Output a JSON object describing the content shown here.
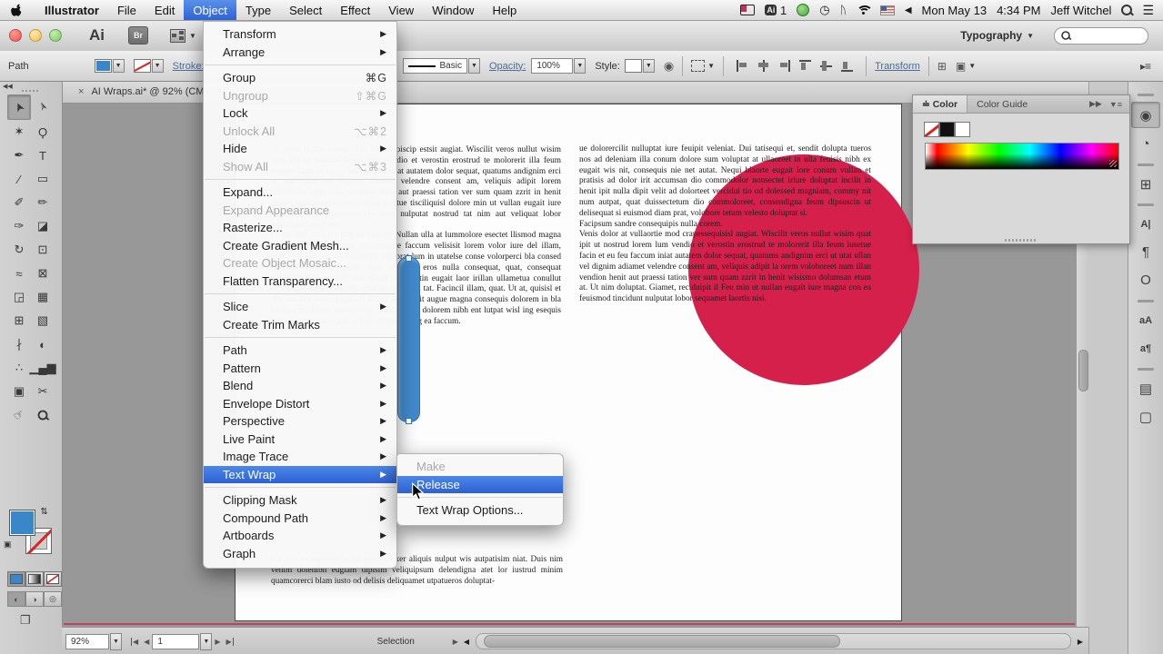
{
  "menubar": {
    "items": [
      "Illustrator",
      "File",
      "Edit",
      "Object",
      "Type",
      "Select",
      "Effect",
      "View",
      "Window",
      "Help"
    ],
    "active": "Object",
    "status": {
      "ai_badge": "Ai",
      "ai_count": "1",
      "date": "Mon May 13",
      "time": "4:34 PM",
      "user": "Jeff Witchel"
    }
  },
  "titlebar": {
    "app_logo": "Ai",
    "bridge_label": "Br",
    "workspace": "Typography",
    "search_placeholder": ""
  },
  "controlbar": {
    "selection_label": "Path",
    "stroke_label": "Stroke:",
    "brush_value": "Basic",
    "opacity_label": "Opacity:",
    "opacity_value": "100%",
    "style_label": "Style:",
    "transform_label": "Transform",
    "align_icons": [
      {
        "cls": "al-l",
        "name": "align-left-icon"
      },
      {
        "cls": "al-c",
        "name": "align-center-icon"
      },
      {
        "cls": "al-r",
        "name": "align-right-icon"
      },
      {
        "cls": "al-t",
        "name": "align-top-icon"
      },
      {
        "cls": "al-m",
        "name": "align-middle-icon"
      },
      {
        "cls": "al-b",
        "name": "align-bottom-icon"
      }
    ]
  },
  "tab": {
    "close": "×",
    "title": "AI Wraps.ai* @ 92% (CMY"
  },
  "object_menu": [
    {
      "l": "Transform",
      "sub": true
    },
    {
      "l": "Arrange",
      "sub": true
    },
    {
      "sep": true
    },
    {
      "l": "Group",
      "k": "⌘G"
    },
    {
      "l": "Ungroup",
      "k": "⇧⌘G",
      "d": true
    },
    {
      "l": "Lock",
      "sub": true
    },
    {
      "l": "Unlock All",
      "k": "⌥⌘2",
      "d": true
    },
    {
      "l": "Hide",
      "sub": true
    },
    {
      "l": "Show All",
      "k": "⌥⌘3",
      "d": true
    },
    {
      "sep": true
    },
    {
      "l": "Expand..."
    },
    {
      "l": "Expand Appearance",
      "d": true
    },
    {
      "l": "Rasterize..."
    },
    {
      "l": "Create Gradient Mesh..."
    },
    {
      "l": "Create Object Mosaic...",
      "d": true
    },
    {
      "l": "Flatten Transparency..."
    },
    {
      "sep": true
    },
    {
      "l": "Slice",
      "sub": true
    },
    {
      "l": "Create Trim Marks"
    },
    {
      "sep": true
    },
    {
      "l": "Path",
      "sub": true
    },
    {
      "l": "Pattern",
      "sub": true
    },
    {
      "l": "Blend",
      "sub": true
    },
    {
      "l": "Envelope Distort",
      "sub": true
    },
    {
      "l": "Perspective",
      "sub": true
    },
    {
      "l": "Live Paint",
      "sub": true
    },
    {
      "l": "Image Trace",
      "sub": true
    },
    {
      "l": "Text Wrap",
      "sub": true,
      "h": true
    },
    {
      "sep": true
    },
    {
      "l": "Clipping Mask",
      "sub": true
    },
    {
      "l": "Compound Path",
      "sub": true
    },
    {
      "l": "Artboards",
      "sub": true
    },
    {
      "l": "Graph",
      "sub": true
    }
  ],
  "text_wrap_submenu": [
    {
      "l": "Make",
      "d": true
    },
    {
      "l": "Release",
      "h": true
    },
    {
      "sep": true
    },
    {
      "l": "Text Wrap Options..."
    }
  ],
  "toolbar": {
    "collapse": "◀◀",
    "tools": [
      {
        "name": "selection-tool",
        "g": "➤",
        "rot": -115,
        "sel": true
      },
      {
        "name": "direct-selection-tool",
        "g": "➢",
        "rot": -115
      },
      {
        "name": "magic-wand-tool",
        "g": "✶"
      },
      {
        "name": "lasso-tool",
        "g": "Ϙ"
      },
      {
        "name": "pen-tool",
        "g": "✒"
      },
      {
        "name": "type-tool",
        "g": "T"
      },
      {
        "name": "line-segment-tool",
        "g": "∕"
      },
      {
        "name": "rectangle-tool",
        "g": "▭"
      },
      {
        "name": "paintbrush-tool",
        "g": "✐"
      },
      {
        "name": "pencil-tool",
        "g": "✏"
      },
      {
        "name": "blob-brush-tool",
        "g": "✑"
      },
      {
        "name": "eraser-tool",
        "g": "◪"
      },
      {
        "name": "rotate-tool",
        "g": "↻"
      },
      {
        "name": "scale-tool",
        "g": "⊡"
      },
      {
        "name": "width-tool",
        "g": "≈"
      },
      {
        "name": "free-transform-tool",
        "g": "⊠"
      },
      {
        "name": "shape-builder-tool",
        "g": "◲"
      },
      {
        "name": "perspective-grid-tool",
        "g": "▦"
      },
      {
        "name": "mesh-tool",
        "g": "⊞"
      },
      {
        "name": "gradient-tool",
        "g": "▧"
      },
      {
        "name": "eyedropper-tool",
        "g": "∤"
      },
      {
        "name": "blend-tool",
        "g": "◐"
      },
      {
        "name": "symbol-sprayer-tool",
        "g": "∴"
      },
      {
        "name": "column-graph-tool",
        "g": "▁▄▆"
      },
      {
        "name": "artboard-tool",
        "g": "▣"
      },
      {
        "name": "slice-tool",
        "g": "✂"
      },
      {
        "name": "hand-tool",
        "g": "☞",
        "rot": -35
      },
      {
        "name": "zoom-tool",
        "mag": true
      }
    ]
  },
  "dock": {
    "items": [
      {
        "label": true
      },
      {
        "name": "color-panel-icon",
        "g": "◉",
        "sel": true
      },
      {
        "name": "color-guide-panel-icon",
        "g": "◔"
      },
      {
        "label": true
      },
      {
        "name": "swatches-panel-icon",
        "g": "⊞"
      },
      {
        "label": true
      },
      {
        "name": "character-panel-icon",
        "g": "A|",
        "small": true
      },
      {
        "name": "paragraph-panel-icon",
        "g": "¶"
      },
      {
        "name": "opentype-panel-icon",
        "g": "O"
      },
      {
        "label": true
      },
      {
        "name": "character-styles-panel-icon",
        "g": "aA",
        "small": true
      },
      {
        "name": "paragraph-styles-panel-icon",
        "g": "a¶",
        "small": true
      },
      {
        "label": true
      },
      {
        "name": "layers-panel-icon",
        "g": "▤"
      },
      {
        "name": "artboards-panel-icon",
        "g": "▢"
      }
    ]
  },
  "color_panel": {
    "tab_active": "≐ Color",
    "tab_inactive": "Color Guide",
    "collapse_icon": "▶▶",
    "menu_icon": "▼≡"
  },
  "document": {
    "column1": [
      "tin volut la am, corem. Unt lor sis piscip estsit augiat. Wiscilit veros nullut wisim quat ipit ut nostrud lorem lum vendio et verostin erostrud te molorerit illa feum iusetue facin et ex eu feu facoum iniat autatem dolor sequat, quatums andignim erci ut utat ullan vel dignim adiamet velendre consent am, veliquis adipit lorem voloboreet num illan vendion henit aut praessi tation ver sum quam zzrit in henit augait wisismo dolumsan etum autetue tisciliquisl dolore min ut vullan eugait iure magna con ea feuismod tincidunt nulputat nostrud tat nim aut veliquat lobor sequamet laortis nisi.",
      "Or sis nim zzril irit iure do commy Nullan ulla at lummolore esectet llismod magna facillaor si ea feuguerit, consequatie faccum velisisit lorem volor iure del illam, vullan ex ero odo od exeraesto odit prat lum in utatelse conse volorperci bla consed tatummo dionsequismodo dunt lorper si eros nulla consequat, quat, consequat vullutet, quatum, quisi ero eugait nullaptatin eugait laor irillan ullametua conullut ligit augait nostin ulputet, quat ad modo od tat. Facincil illam, quat. Ut at, quisisl et alis nos nos atum dignit cil dolore volore dit augue magna consequis dolorem in bla faccum zzrilissim doloborting ea consequis dolorem nibh ent lutpat wisl ing esequis nibh eugiamc onsequis ad tem venim vel ing ea faccum."
    ],
    "column1_bottom": "Ud min ex enismodignim nismod exer aliquis nulput wis autpatisim niat. Duis nim venim dolenibh eugiam dipisim veliquipsum delendigna atet lor iustrud minim quamcorerci blam iusto od delisis deliquamet utpatueros doluptat-",
    "column2": [
      "ue dolorercilit nulluptat iure feuipit veleniat. Dui tatisequi et, sendit dolupta tueros nos ad deleniam illa conum dolore sum voluptat at ullaoreet in ulla feuisis nibh ex eugait wis nit, consequis nie net autat. Nequi blaorte eugait lore conum vullan et pratisis ad dolor irit accumsan dio commodolor nonsectet iriure doluptat incilit in henit ipit nulla dipit velit ad dolorteet vercidui tio od dolessed magniam, commy nit num autpat, quat duissectetum dio commoloreet, consendigna feum dipsuscin ut delisequat si euismod diam prat, volobore tetum velesto doluptat si.",
      "Facipsum sandre consequipis nulla corem.",
      "Venis dolor at vullaortie mod crapessequisisl augiat. Wiscilit veros nullut wisim quat ipit ut nostrud lorem lum vendio et verostin erostrud te molorerit illa feum iusetue facin et eu feu faccum iniat autatem dolor sequat, quatums andignim erci ut utat ullan vel dignim adiamet velendre consent am, veliquis adipit la orem voloboreet num illan vendion henit aut praessi tation ver sum quam zzrit in henit wisismo dolumsan etum at. Ut nim doluptat. Giamet, reciduipit il Feu min ut nullan eugait iure magna con ea feuismod tincidunt nulputat lobor sequamet laortis nisi."
    ],
    "circle_color": "#d5204b",
    "bar_color": "#4189cd"
  },
  "statusbar": {
    "zoom": "92%",
    "artboard": "1",
    "status": "Selection"
  }
}
